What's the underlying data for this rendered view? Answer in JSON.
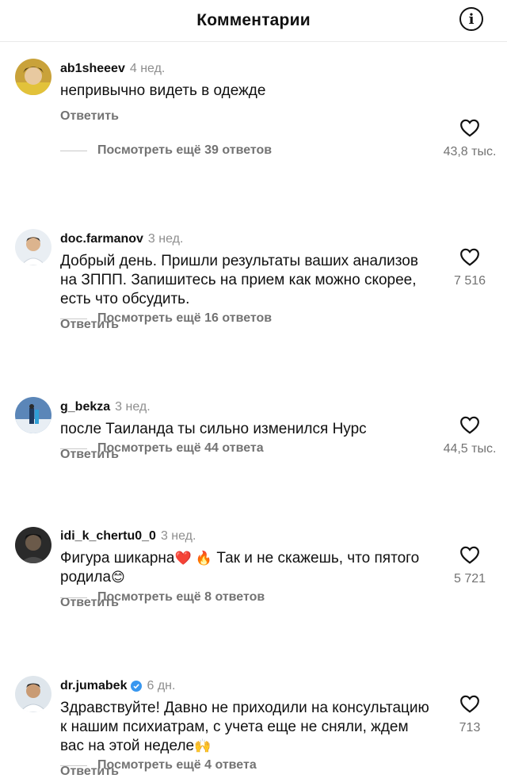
{
  "header": {
    "title": "Комментарии",
    "info_icon": "i"
  },
  "comments": [
    {
      "username": "ab1sheeev",
      "time": "4 нед.",
      "verified": false,
      "text": "непривычно видеть в одежде",
      "reply_label": "Ответить",
      "likes": "43,8 тыс.",
      "view_more": "Посмотреть ещё 39 ответов"
    },
    {
      "username": "doc.farmanov",
      "time": "3 нед.",
      "verified": false,
      "text": "Добрый день. Пришли результаты ваших анализов на ЗППП. Запишитесь на прием как можно скорее, есть что обсудить.",
      "reply_label": "Ответить",
      "likes": "7 516",
      "view_more": "Посмотреть ещё 16 ответов"
    },
    {
      "username": "g_bekza",
      "time": "3 нед.",
      "verified": false,
      "text": "после Таиланда ты сильно изменился Нурс",
      "reply_label": "Ответить",
      "likes": "44,5 тыс.",
      "view_more": "Посмотреть ещё 44 ответа"
    },
    {
      "username": "idi_k_chertu0_0",
      "time": "3 нед.",
      "verified": false,
      "text_before": "Фигура шикарна",
      "emoji_1": "❤️",
      "emoji_2": "🔥",
      "text_middle": " Так и не скажешь, что пятого родила",
      "emoji_3": "😊",
      "reply_label": "Ответить",
      "likes": "5 721",
      "view_more": "Посмотреть ещё 8 ответов"
    },
    {
      "username": "dr.jumabek",
      "time": "6 дн.",
      "verified": true,
      "text": "Здравствуйте! Давно не приходили на консультацию к нашим психиатрам, с учета еще не сняли, ждем вас на этой неделе",
      "emoji": "🙌",
      "reply_label": "Ответить",
      "likes": "713",
      "view_more": "Посмотреть ещё 4 ответа"
    }
  ],
  "colors": {
    "text": "#111111",
    "secondary": "#737373",
    "verified": "#3897f0"
  }
}
